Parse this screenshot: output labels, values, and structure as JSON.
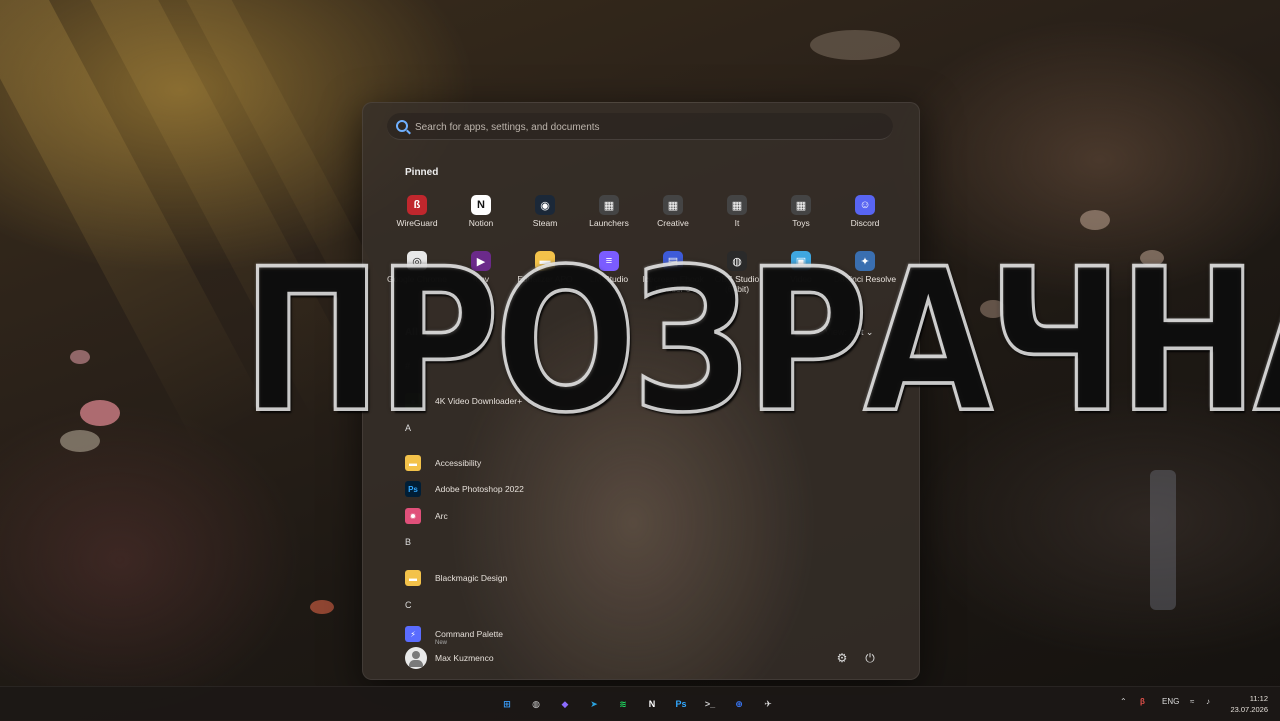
{
  "search": {
    "placeholder": "Search for apps, settings, and documents"
  },
  "pinned": {
    "label": "Pinned",
    "items": [
      {
        "label": "WireGuard",
        "icon": "wireguard-icon",
        "color": "#c0272d"
      },
      {
        "label": "Notion",
        "icon": "notion-icon",
        "color": "#ffffff"
      },
      {
        "label": "Steam",
        "icon": "steam-icon",
        "color": "#1b2838"
      },
      {
        "label": "Launchers",
        "icon": "folder-grid-icon",
        "color": "#444444"
      },
      {
        "label": "Creative",
        "icon": "folder-grid-icon",
        "color": "#444444"
      },
      {
        "label": "It",
        "icon": "folder-grid-icon",
        "color": "#444444"
      },
      {
        "label": "Toys",
        "icon": "folder-grid-icon",
        "color": "#444444"
      },
      {
        "label": "Discord",
        "icon": "discord-icon",
        "color": "#5865f2"
      },
      {
        "label": "Google Chrome",
        "icon": "chrome-icon",
        "color": "#e8e8e8"
      },
      {
        "label": "mpv",
        "icon": "mpv-icon",
        "color": "#6b2a8a"
      },
      {
        "label": "Equalizer APO",
        "icon": "folder-icon",
        "color": "#f3c24a"
      },
      {
        "label": "LM Studio",
        "icon": "lmstudio-icon",
        "color": "#7b5cff"
      },
      {
        "label": "Icecream Ebook Reader 6",
        "icon": "ebook-icon",
        "color": "#3d5bd9"
      },
      {
        "label": "OBS Studio (64bit)",
        "icon": "obs-icon",
        "color": "#2a2a2a"
      },
      {
        "label": "Video",
        "icon": "video-icon",
        "color": "#3fa7e0"
      },
      {
        "label": "DaVinci Resolve",
        "icon": "davinci-icon",
        "color": "#3a6fb0"
      }
    ]
  },
  "all": {
    "label": "All",
    "view_label": "View: List",
    "groups": [
      {
        "letter": "#",
        "apps": [
          {
            "name": "4K Video Downloader+",
            "icon": "4k-downloader-icon",
            "color": "#6cbf3a"
          }
        ]
      },
      {
        "letter": "A",
        "apps": [
          {
            "name": "Accessibility",
            "icon": "folder-icon",
            "color": "#f3c24a"
          },
          {
            "name": "Adobe Photoshop 2022",
            "icon": "photoshop-icon",
            "color": "#001e36"
          },
          {
            "name": "Arc",
            "icon": "arc-icon",
            "color": "#e0507a"
          }
        ]
      },
      {
        "letter": "B",
        "apps": [
          {
            "name": "Blackmagic Design",
            "icon": "folder-icon",
            "color": "#f3c24a"
          }
        ]
      },
      {
        "letter": "C",
        "apps": [
          {
            "name": "Command Palette",
            "sub": "New",
            "icon": "command-palette-icon",
            "color": "#5a6cff"
          }
        ]
      }
    ]
  },
  "user": {
    "name": "Max Kuzmenco"
  },
  "overlay": {
    "title": "ПРОЗРАЧНАЯ"
  },
  "taskbar": {
    "apps": [
      {
        "name": "start",
        "icon": "windows-icon",
        "color": "#3aa0ff"
      },
      {
        "name": "obs",
        "icon": "obs-icon",
        "color": "#cccccc"
      },
      {
        "name": "proton-vpn",
        "icon": "vpn-icon",
        "color": "#8b6cff"
      },
      {
        "name": "telegram",
        "icon": "telegram-icon",
        "color": "#2aa3df"
      },
      {
        "name": "spotify",
        "icon": "spotify-icon",
        "color": "#1ed760"
      },
      {
        "name": "notion",
        "icon": "notion-icon",
        "color": "#ffffff"
      },
      {
        "name": "photoshop",
        "icon": "photoshop-icon",
        "color": "#31a8ff"
      },
      {
        "name": "terminal",
        "icon": "terminal-icon",
        "color": "#cccccc"
      },
      {
        "name": "network",
        "icon": "network-icon",
        "color": "#3a7bff"
      },
      {
        "name": "windscribe",
        "icon": "windscribe-icon",
        "color": "#dddddd"
      }
    ],
    "tray": {
      "lang": "ENG"
    },
    "clock": {
      "time": "11:12",
      "date": "23.07.2026"
    }
  }
}
